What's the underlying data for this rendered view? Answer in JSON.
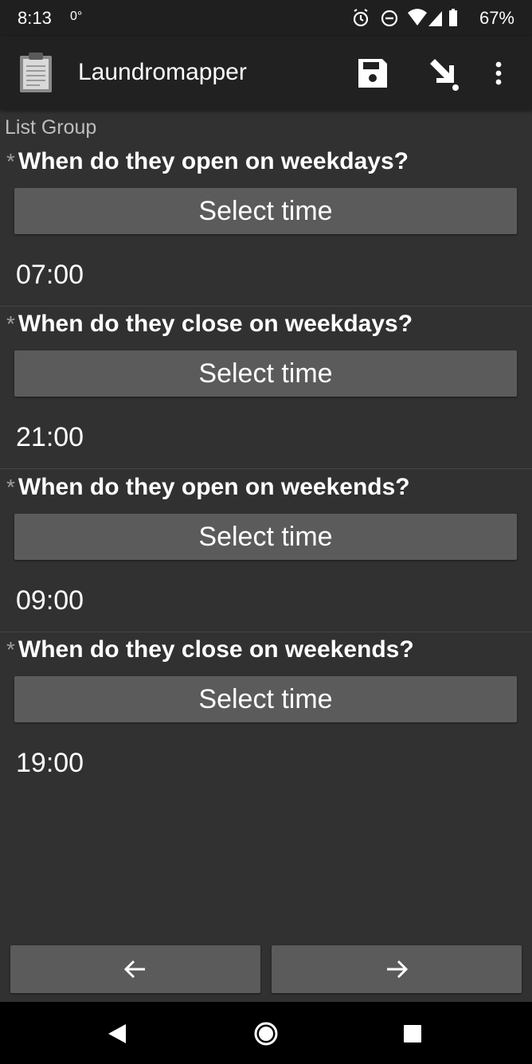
{
  "status_bar": {
    "time": "8:13",
    "temp": "0°",
    "battery": "67%",
    "icons": [
      "alarm-icon",
      "do-not-disturb-icon",
      "wifi-icon",
      "signal-icon",
      "battery-icon"
    ]
  },
  "app_bar": {
    "title": "Laundromapper",
    "actions": [
      "save-icon",
      "jump-icon",
      "more-vert-icon"
    ]
  },
  "group_label": "List Group",
  "questions": [
    {
      "required": "*",
      "label": "When do they open on weekdays?",
      "button": "Select time",
      "value": "07:00"
    },
    {
      "required": "*",
      "label": "When do they close on weekdays?",
      "button": "Select time",
      "value": "21:00"
    },
    {
      "required": "*",
      "label": "When do they open on weekends?",
      "button": "Select time",
      "value": "09:00"
    },
    {
      "required": "*",
      "label": "When do they close on weekends?",
      "button": "Select time",
      "value": "19:00"
    }
  ],
  "nav": {
    "prev_icon": "arrow-left-icon",
    "next_icon": "arrow-right-icon"
  },
  "system_nav": [
    "back-icon",
    "home-icon",
    "recents-icon"
  ],
  "colors": {
    "background": "#313131",
    "app_bar": "#212121",
    "button": "#5b5b5b"
  }
}
